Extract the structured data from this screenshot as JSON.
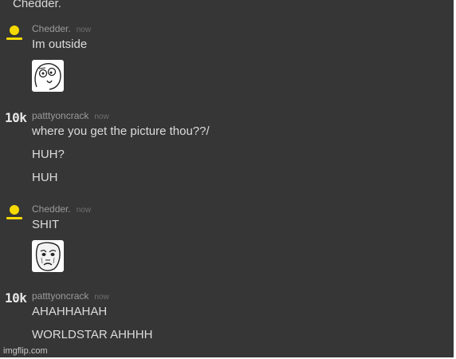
{
  "top_partial": {
    "text": "Chedder."
  },
  "messages": [
    {
      "username": "Chedder.",
      "time": "now",
      "avatar": {
        "icon": "yellow-person-icon",
        "color": "#f5d900"
      },
      "lines": [
        "Im outside"
      ],
      "image": {
        "icon": "derp-rage-face-icon"
      }
    },
    {
      "username": "patttyoncrack",
      "time": "now",
      "avatar": {
        "text": "10k"
      },
      "lines": [
        "where you get the picture thou??/",
        "HUH?",
        "HUH"
      ]
    },
    {
      "username": "Chedder.",
      "time": "now",
      "avatar": {
        "icon": "yellow-person-icon",
        "color": "#f5d900"
      },
      "lines": [
        "SHIT"
      ],
      "image": {
        "icon": "okay-rage-face-icon"
      }
    },
    {
      "username": "patttyoncrack",
      "time": "now",
      "avatar": {
        "text": "10k"
      },
      "lines": [
        "AHAHHAHAH",
        "WORLDSTAR AHHHH"
      ]
    }
  ],
  "watermark": {
    "text": "imgflip.com"
  },
  "colors": {
    "background": "#363636",
    "message_text": "#dcdcdc",
    "username": "#9b9b9b",
    "timestamp": "#6f6f6f",
    "avatar_yellow": "#f5d900"
  }
}
